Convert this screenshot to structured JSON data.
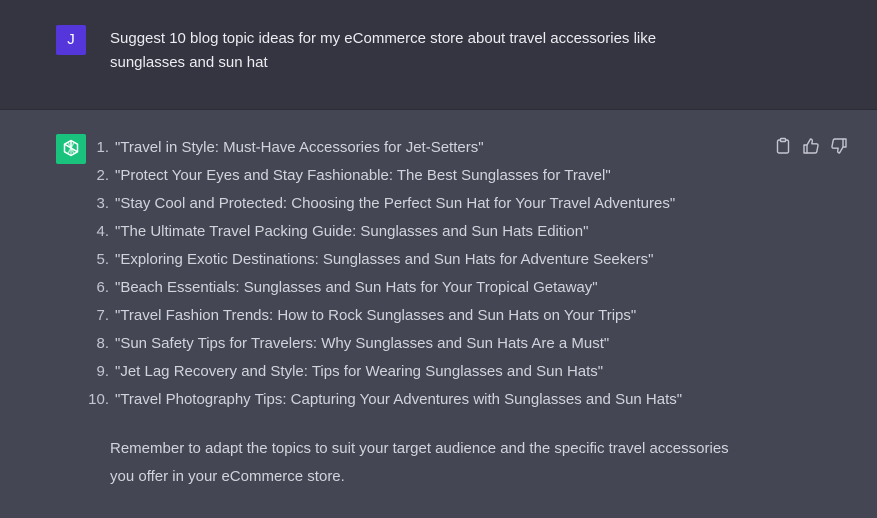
{
  "user_message": {
    "avatar_initial": "J",
    "text": "Suggest 10 blog topic ideas for my eCommerce store about travel accessories like sunglasses and sun hat"
  },
  "assistant_message": {
    "items": [
      {
        "number": "1.",
        "text": "\"Travel in Style: Must-Have Accessories for Jet-Setters\""
      },
      {
        "number": "2.",
        "text": "\"Protect Your Eyes and Stay Fashionable: The Best Sunglasses for Travel\""
      },
      {
        "number": "3.",
        "text": "\"Stay Cool and Protected: Choosing the Perfect Sun Hat for Your Travel Adventures\""
      },
      {
        "number": "4.",
        "text": "\"The Ultimate Travel Packing Guide: Sunglasses and Sun Hats Edition\""
      },
      {
        "number": "5.",
        "text": "\"Exploring Exotic Destinations: Sunglasses and Sun Hats for Adventure Seekers\""
      },
      {
        "number": "6.",
        "text": "\"Beach Essentials: Sunglasses and Sun Hats for Your Tropical Getaway\""
      },
      {
        "number": "7.",
        "text": "\"Travel Fashion Trends: How to Rock Sunglasses and Sun Hats on Your Trips\""
      },
      {
        "number": "8.",
        "text": "\"Sun Safety Tips for Travelers: Why Sunglasses and Sun Hats Are a Must\""
      },
      {
        "number": "9.",
        "text": "\"Jet Lag Recovery and Style: Tips for Wearing Sunglasses and Sun Hats\""
      },
      {
        "number": "10.",
        "text": "\"Travel Photography Tips: Capturing Your Adventures with Sunglasses and Sun Hats\""
      }
    ],
    "closing": "Remember to adapt the topics to suit your target audience and the specific travel accessories you offer in your eCommerce store."
  },
  "actions": {
    "icons": [
      "clipboard-icon",
      "thumbs-up-icon",
      "thumbs-down-icon"
    ]
  },
  "colors": {
    "user_bg": "#343541",
    "assistant_bg": "#444654",
    "user_avatar": "#5436da",
    "gpt_avatar": "#19c37d",
    "text": "#d1d5db"
  }
}
